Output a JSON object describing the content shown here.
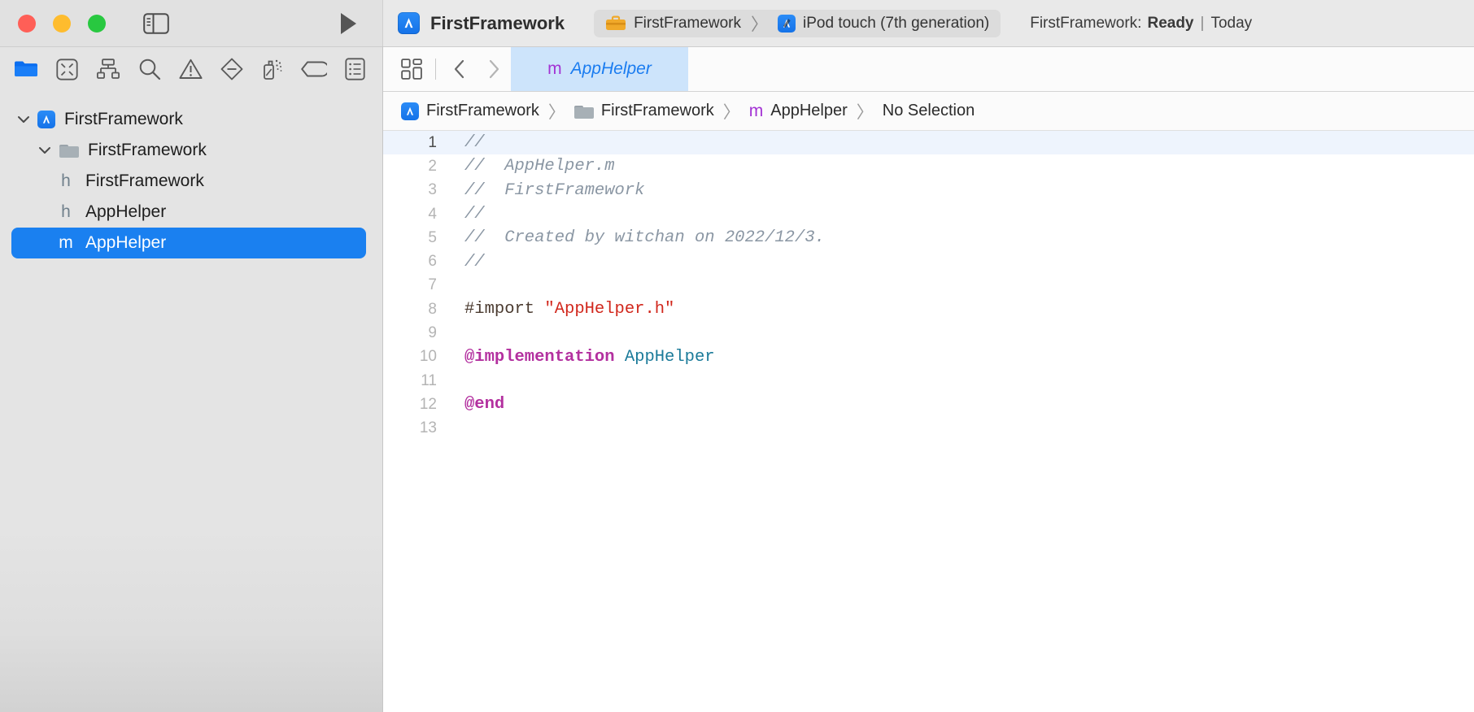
{
  "titlebar": {
    "traffic_lights": [
      {
        "name": "close",
        "color": "#ff5f57"
      },
      {
        "name": "minimize",
        "color": "#febc2e"
      },
      {
        "name": "maximize",
        "color": "#28c840"
      }
    ],
    "sidebar_toggle_icon": "sidebar-toggle-icon",
    "run_button_icon": "run-play-icon",
    "app_icon": "xcode-app-icon",
    "window_title": "FirstFramework",
    "scheme": {
      "target_icon": "toolbox-icon",
      "target_name": "FirstFramework",
      "separator": "〉",
      "destination_icon": "simulator-icon",
      "destination_name": "iPod touch (7th generation)"
    },
    "status": {
      "prefix": "FirstFramework:",
      "state": "Ready",
      "separator": "|",
      "time": "Today"
    }
  },
  "navigator": {
    "toolbar_icons": [
      {
        "name": "folder-icon",
        "active": true
      },
      {
        "name": "source-control-icon",
        "active": false
      },
      {
        "name": "symbol-hierarchy-icon",
        "active": false
      },
      {
        "name": "search-icon",
        "active": false
      },
      {
        "name": "issue-warning-icon",
        "active": false
      },
      {
        "name": "test-diamond-icon",
        "active": false
      },
      {
        "name": "debug-spray-icon",
        "active": false
      },
      {
        "name": "breakpoint-tag-icon",
        "active": false
      },
      {
        "name": "report-log-icon",
        "active": false
      }
    ],
    "tree": [
      {
        "label": "FirstFramework",
        "icon": "xcode-project-icon",
        "badge": "",
        "indent": 0,
        "disclosure": "open",
        "selected": false
      },
      {
        "label": "FirstFramework",
        "icon": "folder-icon",
        "badge": "",
        "indent": 1,
        "disclosure": "open",
        "selected": false
      },
      {
        "label": "FirstFramework",
        "icon": "",
        "badge": "h",
        "indent": 2,
        "disclosure": "",
        "selected": false
      },
      {
        "label": "AppHelper",
        "icon": "",
        "badge": "h",
        "indent": 2,
        "disclosure": "",
        "selected": false
      },
      {
        "label": "AppHelper",
        "icon": "",
        "badge": "m",
        "indent": 2,
        "disclosure": "",
        "selected": true
      }
    ]
  },
  "editor": {
    "toolbar_icons": [
      {
        "name": "editor-options-icon"
      },
      {
        "name": "grid-layout-icon"
      },
      {
        "name": "back-chevron-icon"
      },
      {
        "name": "forward-chevron-icon"
      }
    ],
    "tab": {
      "badge": "m",
      "name": "AppHelper"
    },
    "breadcrumb": [
      {
        "icon": "xcode-project-icon",
        "label": "FirstFramework"
      },
      {
        "icon": "folder-icon",
        "label": "FirstFramework"
      },
      {
        "icon": "m-badge",
        "label": "AppHelper"
      },
      {
        "icon": "",
        "label": "No Selection"
      }
    ],
    "breadcrumb_separator": "〉",
    "code": {
      "language": "objective-c",
      "highlighted_line": 1,
      "lines": [
        {
          "n": 1,
          "tokens": [
            {
              "t": "//",
              "c": "comment"
            }
          ]
        },
        {
          "n": 2,
          "tokens": [
            {
              "t": "//  AppHelper.m",
              "c": "comment"
            }
          ]
        },
        {
          "n": 3,
          "tokens": [
            {
              "t": "//  FirstFramework",
              "c": "comment"
            }
          ]
        },
        {
          "n": 4,
          "tokens": [
            {
              "t": "//",
              "c": "comment"
            }
          ]
        },
        {
          "n": 5,
          "tokens": [
            {
              "t": "//  Created by witchan on 2022/12/3.",
              "c": "comment"
            }
          ]
        },
        {
          "n": 6,
          "tokens": [
            {
              "t": "//",
              "c": "comment"
            }
          ]
        },
        {
          "n": 7,
          "tokens": []
        },
        {
          "n": 8,
          "tokens": [
            {
              "t": "#import ",
              "c": "pre"
            },
            {
              "t": "\"AppHelper.h\"",
              "c": "str"
            }
          ]
        },
        {
          "n": 9,
          "tokens": []
        },
        {
          "n": 10,
          "tokens": [
            {
              "t": "@implementation",
              "c": "kw"
            },
            {
              "t": " ",
              "c": "plain"
            },
            {
              "t": "AppHelper",
              "c": "type"
            }
          ]
        },
        {
          "n": 11,
          "tokens": []
        },
        {
          "n": 12,
          "tokens": [
            {
              "t": "@end",
              "c": "kw"
            }
          ]
        },
        {
          "n": 13,
          "tokens": []
        }
      ]
    }
  },
  "colors": {
    "accent": "#1a80f0",
    "tab_active_bg": "#cde4fb",
    "keyword": "#b3309f",
    "string": "#d1271c",
    "comment": "#8a96a3",
    "type": "#1a7a99",
    "m_badge": "#a333d4",
    "h_badge": "#70808c"
  }
}
